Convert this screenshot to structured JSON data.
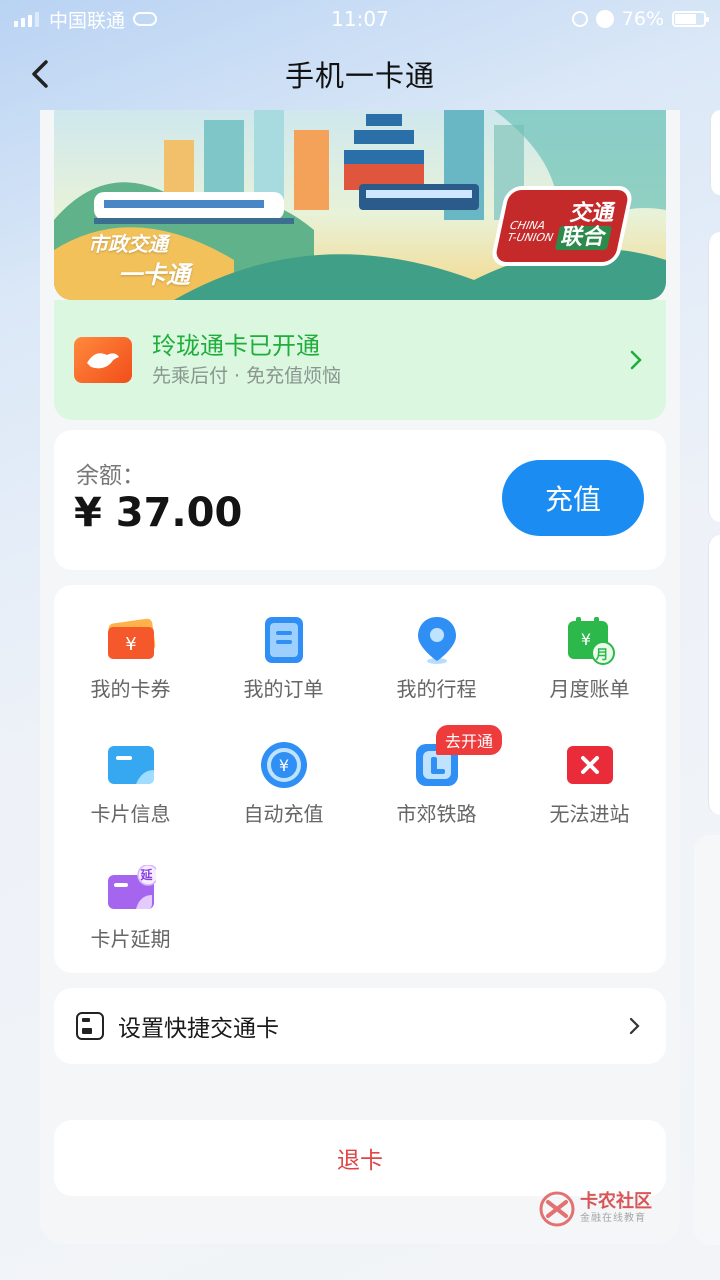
{
  "status_bar": {
    "carrier": "中国联通",
    "time": "11:07",
    "battery": "76%"
  },
  "nav": {
    "title": "手机一卡通"
  },
  "banner": {
    "logo_line1": "市政交通",
    "logo_line2": "一卡通",
    "tunion_line1": "交通",
    "tunion_line2": "联合",
    "tunion_tag_line1": "CHINA",
    "tunion_tag_line2": "T-UNION"
  },
  "linglong": {
    "title": "玲珑通卡已开通",
    "subtitle": "先乘后付 · 免充值烦恼"
  },
  "balance": {
    "label": "余额：",
    "amount": "¥ 37.00",
    "recharge_label": "充值"
  },
  "services": [
    {
      "label": "我的卡券",
      "icon": "coupon-icon"
    },
    {
      "label": "我的订单",
      "icon": "order-icon"
    },
    {
      "label": "我的行程",
      "icon": "location-pin-icon"
    },
    {
      "label": "月度账单",
      "icon": "monthly-bill-icon",
      "icon_text": "月"
    },
    {
      "label": "卡片信息",
      "icon": "card-info-icon"
    },
    {
      "label": "自动充值",
      "icon": "auto-recharge-icon"
    },
    {
      "label": "市郊铁路",
      "icon": "suburban-rail-icon",
      "badge": "去开通"
    },
    {
      "label": "无法进站",
      "icon": "cannot-enter-icon"
    },
    {
      "label": "卡片延期",
      "icon": "card-extend-icon",
      "icon_text": "延"
    }
  ],
  "settings": {
    "shortcut_label": "设置快捷交通卡",
    "exit_label": "退卡"
  },
  "watermark": {
    "title": "卡农社区",
    "subtitle": "金融在线教育"
  },
  "colors": {
    "accent": "#1a8cf2",
    "success": "#1fae3c",
    "danger": "#e04545"
  }
}
